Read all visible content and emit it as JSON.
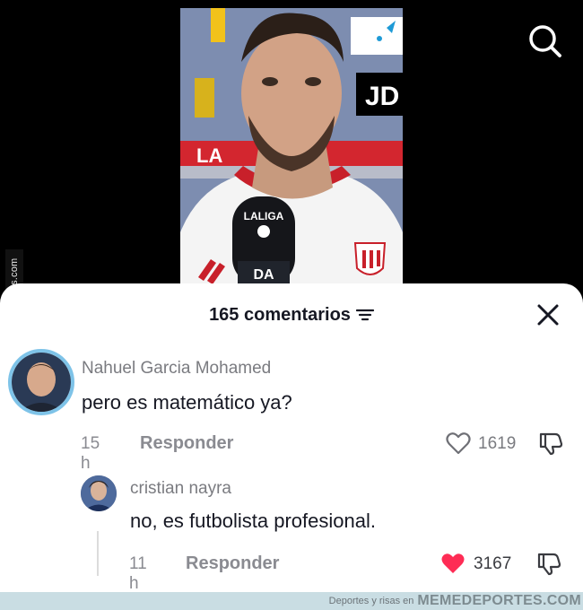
{
  "video": {
    "mic_label_top": "LALIGA",
    "mic_label_bottom": "DA",
    "sponsor_text": "JD",
    "board_text": "LA"
  },
  "side_watermark": "Memedeportes.com",
  "comments_header": {
    "count_label": "165 comentarios"
  },
  "comments": [
    {
      "author": "Nahuel Garcia Mohamed",
      "text": "pero es matemático ya?",
      "time": "15 h",
      "reply_label": "Responder",
      "likes": "1619",
      "liked": false
    }
  ],
  "replies": [
    {
      "author": "cristian nayra",
      "text": "no, es futbolista profesional.",
      "time": "11 h",
      "reply_label": "Responder",
      "likes": "3167",
      "liked": true
    }
  ],
  "footer": {
    "small_text": "Deportes y risas en",
    "brand": "MEMEDEPORTES.COM"
  },
  "colors": {
    "liked_heart": "#fe2c55",
    "avatar_ring": "#7ec3e8",
    "footer_bg": "#c9dde3"
  }
}
